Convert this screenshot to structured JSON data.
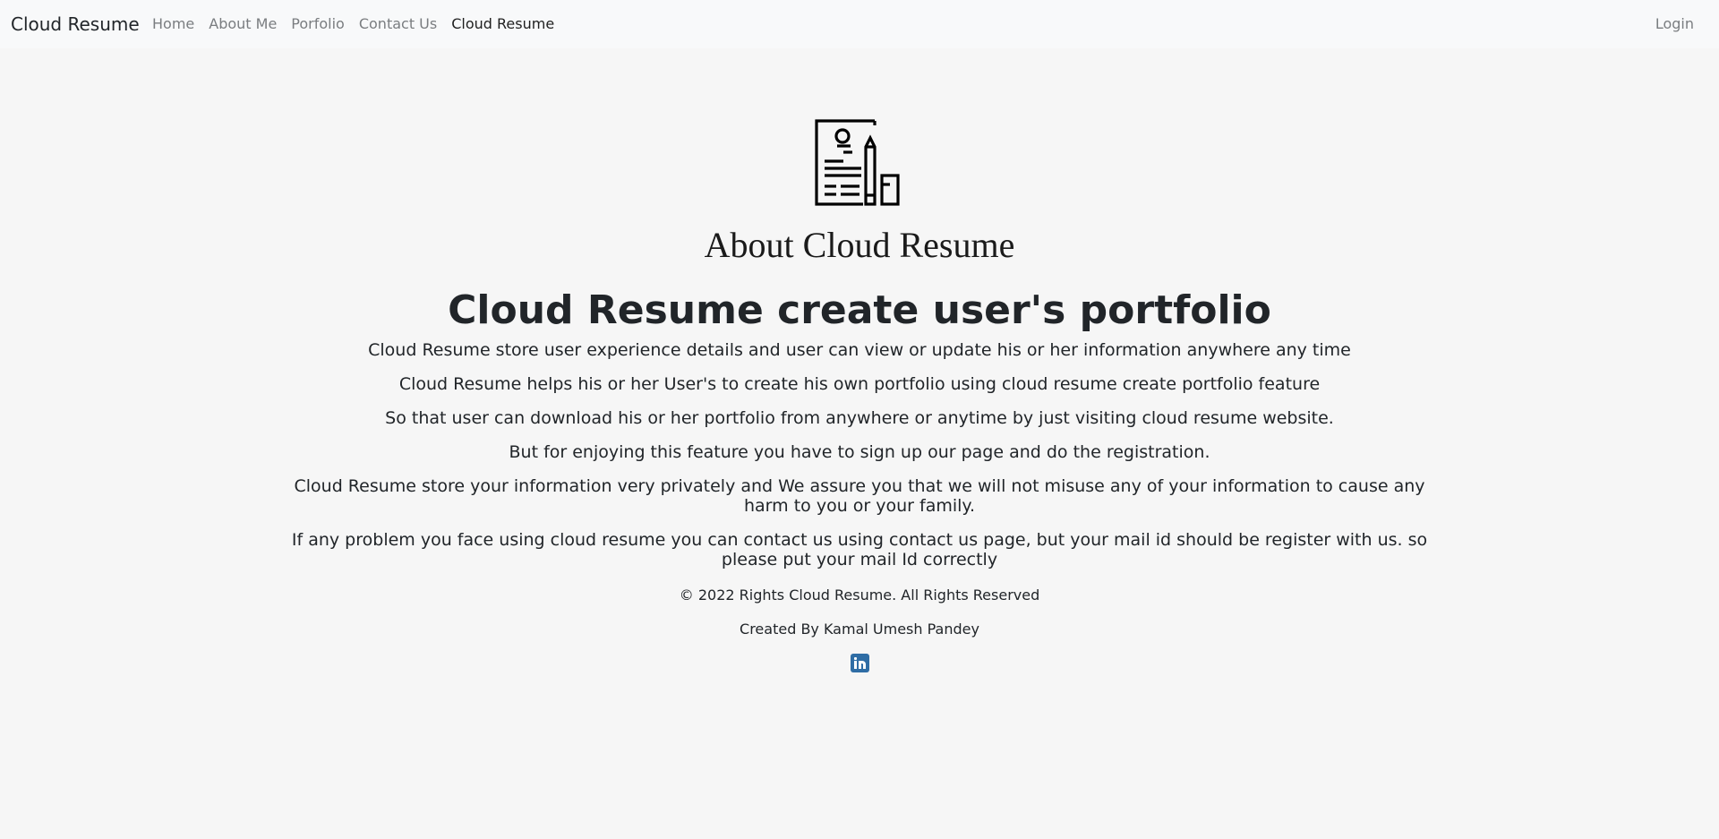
{
  "navbar": {
    "brand": "Cloud Resume",
    "links": [
      {
        "label": "Home"
      },
      {
        "label": "About Me"
      },
      {
        "label": "Porfolio"
      },
      {
        "label": "Contact Us"
      },
      {
        "label": "Cloud Resume"
      }
    ],
    "active_link": "Cloud Resume",
    "login": "Login"
  },
  "logo": {
    "icon": "resume-document-icon"
  },
  "main": {
    "about_title": "About Cloud Resume",
    "headline": "Cloud Resume create user's portfolio",
    "paragraphs": [
      "Cloud Resume store user experience details and user can view or update his or her information anywhere any time",
      "Cloud Resume helps his or her User's to create his own portfolio using cloud resume create portfolio feature",
      "So that user can download his or her portfolio from anywhere or anytime by just visiting cloud resume website.",
      "But for enjoying this feature you have to sign up our page and do the registration.",
      "Cloud Resume store your information very privately and We assure you that we will not misuse any of your information to cause any harm to you or your family.",
      "If any problem you face using cloud resume you can contact us using contact us page, but your mail id should be register with us. so please put your mail Id correctly"
    ]
  },
  "footer": {
    "copyright": "© 2022 Rights Cloud Resume. All Rights Reserved",
    "created_by": "Created By Kamal Umesh Pandey",
    "social_icon": "linkedin-icon",
    "social_color": "#2f6da5"
  },
  "colors": {
    "background": "#f6f6f6",
    "navbar_background": "#f8f9fa",
    "nav_link": "#7a7d80",
    "text": "#212529"
  }
}
